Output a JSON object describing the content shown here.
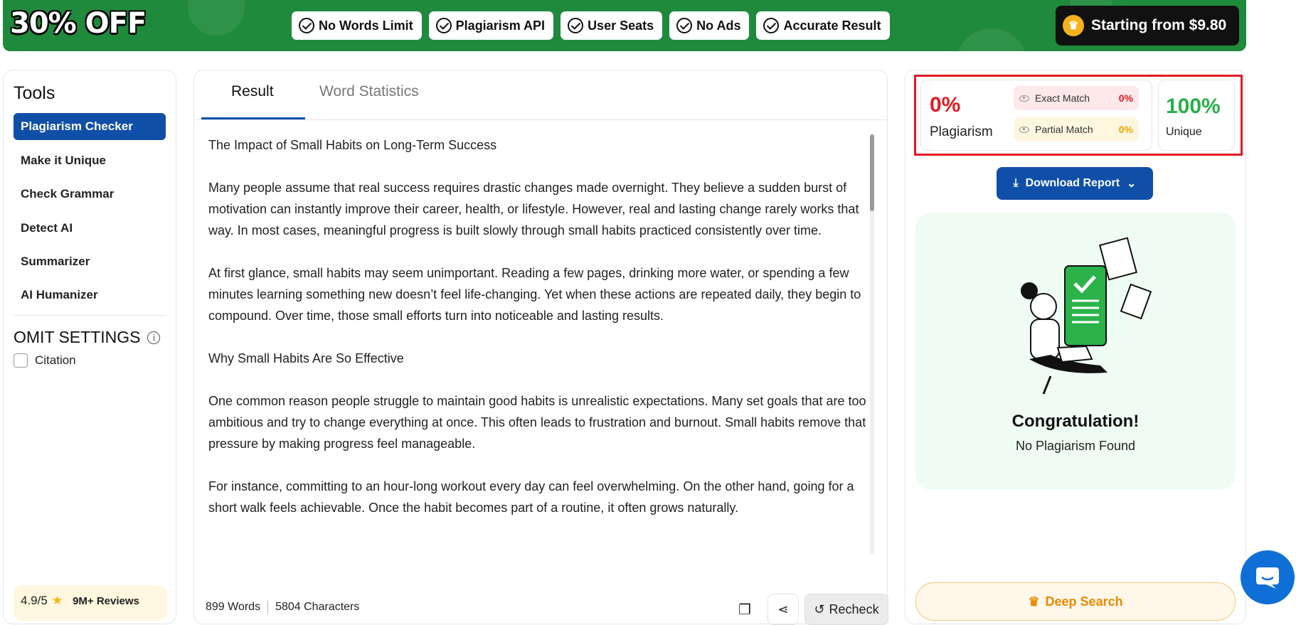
{
  "banner": {
    "discount": "30% OFF",
    "features": [
      "No Words Limit",
      "Plagiarism API",
      "User Seats",
      "No Ads",
      "Accurate Result"
    ],
    "price_label": "Starting from $9.80"
  },
  "sidebar": {
    "title": "Tools",
    "items": [
      {
        "label": "Plagiarism Checker",
        "active": true
      },
      {
        "label": "Make it Unique",
        "active": false
      },
      {
        "label": "Check Grammar",
        "active": false
      },
      {
        "label": "Detect AI",
        "active": false
      },
      {
        "label": "Summarizer",
        "active": false
      },
      {
        "label": "AI Humanizer",
        "active": false
      }
    ],
    "omit_title": "OMIT SETTINGS",
    "citation_label": "Citation",
    "rating": "4.9/5",
    "reviews": "9M+ Reviews"
  },
  "main": {
    "tabs": [
      "Result",
      "Word Statistics"
    ],
    "paragraphs": [
      "The Impact of Small Habits on Long-Term Success",
      "Many people assume that real success requires drastic changes made overnight. They believe a sudden burst of motivation can instantly improve their career, health, or lifestyle. However, real and lasting change rarely works that way. In most cases, meaningful progress is built slowly through small habits practiced consistently over time.",
      "At first glance, small habits may seem unimportant. Reading a few pages, drinking more water, or spending a few minutes learning something new doesn’t feel life-changing. Yet when these actions are repeated daily, they begin to compound. Over time, those small efforts turn into noticeable and lasting results.",
      "Why Small Habits Are So Effective",
      "One common reason people struggle to maintain good habits is unrealistic expectations. Many set goals that are too ambitious and try to change everything at once. This often leads to frustration and burnout. Small habits remove that pressure by making progress feel manageable.",
      "For instance, committing to an hour-long workout every day can feel overwhelming. On the other hand, going for a short walk feels achievable. Once the habit becomes part of a routine, it often grows naturally."
    ],
    "word_count": "899 Words",
    "char_count": "5804 Characters",
    "recheck_label": "Recheck"
  },
  "results": {
    "plagiarism_pct": "0%",
    "plagiarism_label": "Plagiarism",
    "exact_label": "Exact Match",
    "exact_pct": "0%",
    "partial_label": "Partial Match",
    "partial_pct": "0%",
    "unique_pct": "100%",
    "unique_label": "Unique",
    "download_label": "Download Report",
    "congrats_title": "Congratulation!",
    "congrats_sub": "No Plagiarism Found",
    "deep_search_label": "Deep Search"
  },
  "colors": {
    "brand_blue": "#0f4fa8",
    "banner_green": "#1f8a3c",
    "alert_red": "#e01b24",
    "success_green": "#28b04a"
  }
}
